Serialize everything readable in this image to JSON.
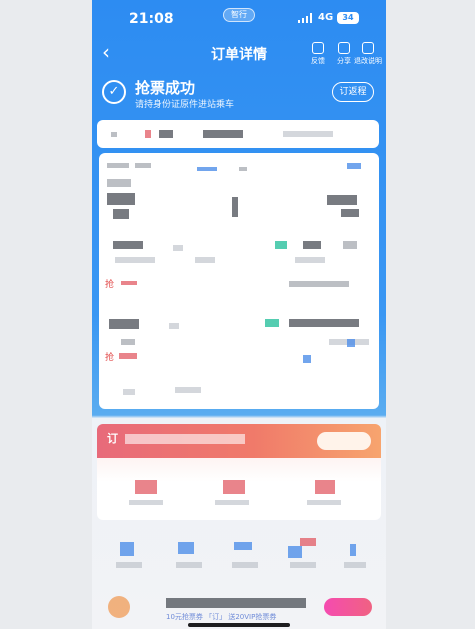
{
  "status_bar": {
    "time": "21:08",
    "pill_text": "智行",
    "network": "4G",
    "battery": "34"
  },
  "nav": {
    "title": "订单详情",
    "actions": [
      {
        "label": "反馈",
        "icon": "feedback-icon"
      },
      {
        "label": "分享",
        "icon": "share-icon"
      },
      {
        "label": "退改说明",
        "icon": "refund-info-icon"
      }
    ]
  },
  "success": {
    "title": "抢票成功",
    "subtitle": "请持身份证原件进站乘车",
    "return_button": "订返程"
  },
  "order_card": {
    "grab_label_1": "抢",
    "grab_label_2": "抢"
  },
  "promo": {
    "band_text": "订"
  },
  "bottom_bar": {
    "vip_text": "10元抢票券 「订」 送20VIP抢票券"
  },
  "colors": {
    "primary_blue": "#2d8cf2",
    "promo_red": "#e86a7a",
    "accent_green": "#37c4a3",
    "accent_pink": "#f54bb0"
  }
}
